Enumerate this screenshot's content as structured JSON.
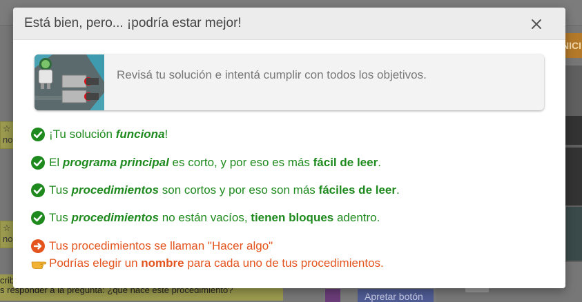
{
  "modal": {
    "title": "Está bien, pero... ¡podría estar mejor!",
    "close_icon": "close-icon",
    "info": {
      "message": "Revisá tu solución e intentá cumplir con todos los objetivos."
    },
    "checks": [
      {
        "icon": "check-circle-icon",
        "parts": [
          "¡Tu solución ",
          "funciona",
          "!"
        ]
      },
      {
        "icon": "check-circle-icon",
        "parts": [
          "El ",
          "programa principal",
          " es corto, y por eso es más ",
          "fácil de leer",
          "."
        ]
      },
      {
        "icon": "check-circle-icon",
        "parts": [
          "Tus ",
          "procedimientos",
          " son cortos y por eso son más ",
          "fáciles de leer",
          "."
        ]
      },
      {
        "icon": "check-circle-icon",
        "parts": [
          "Tus ",
          "procedimientos",
          " no están vacíos, ",
          "tienen bloques",
          " adentro."
        ]
      }
    ],
    "warning": {
      "icon": "arrow-circle-icon",
      "message": "Tus procedimientos se llaman \"Hacer algo\"",
      "hint_icon": "pointing-hand-icon",
      "hint_parts": [
        "Podrías elegir un ",
        "nombre",
        " para cada uno de tus procedimientos."
      ]
    },
    "colors": {
      "success": "#1e8a1e",
      "warning": "#e4541e",
      "header_bg": "#ececec"
    }
  },
  "background": {
    "top_right_button": "NICI",
    "left_notes": [
      "☆ no",
      "☆ no"
    ],
    "bottom_note_lines": [
      "cribi",
      "s responder a la pregunta: ¿qué hace este procedimiento?"
    ],
    "apretar_button": "Apretar botón"
  }
}
